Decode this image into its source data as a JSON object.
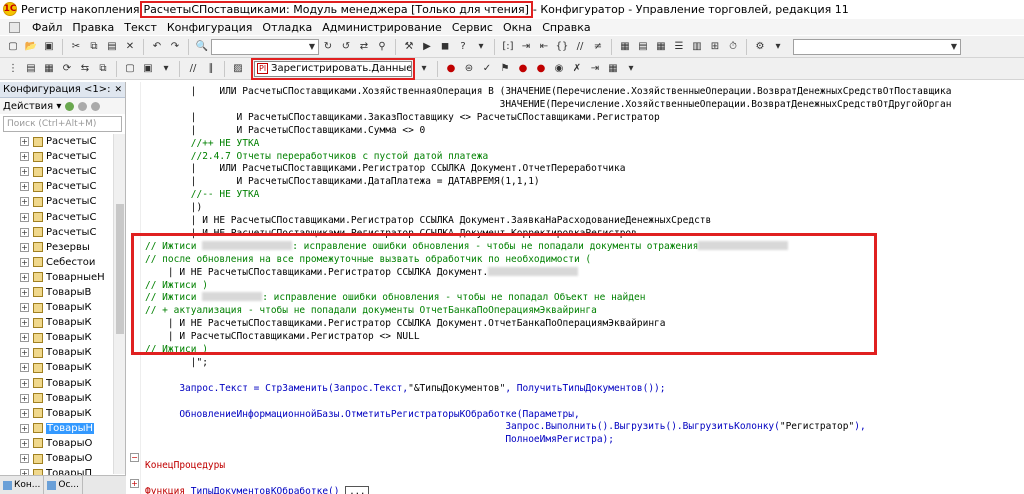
{
  "titlebar": {
    "prefix": "Регистр накопления ",
    "highlighted": "РасчетыСПоставщиками: Модуль менеджера [Только для чтения]",
    "suffix": " - Конфигуратор - Управление торговлей, редакция 11",
    "app_icon": "1С"
  },
  "menu": [
    "Файл",
    "Правка",
    "Текст",
    "Конфигурация",
    "Отладка",
    "Администрирование",
    "Сервис",
    "Окна",
    "Справка"
  ],
  "toolbar": {
    "search_placeholder": "",
    "register_combo": "Зарегистрировать.ДанныеКОбр"
  },
  "left_panel": {
    "title": "Конфигурация <1>:",
    "close": "✕",
    "actions_label": "Действия ▾",
    "search_placeholder": "Поиск (Ctrl+Alt+M)",
    "items": [
      {
        "label": "РасчетыС",
        "selected": false
      },
      {
        "label": "РасчетыС",
        "selected": false
      },
      {
        "label": "РасчетыС",
        "selected": false
      },
      {
        "label": "РасчетыС",
        "selected": false
      },
      {
        "label": "РасчетыС",
        "selected": false
      },
      {
        "label": "РасчетыС",
        "selected": false
      },
      {
        "label": "РасчетыС",
        "selected": false
      },
      {
        "label": "Резервы",
        "selected": false
      },
      {
        "label": "Себестои",
        "selected": false
      },
      {
        "label": "ТоварныеН",
        "selected": false
      },
      {
        "label": "ТоварыВ",
        "selected": false
      },
      {
        "label": "ТоварыК",
        "selected": false
      },
      {
        "label": "ТоварыК",
        "selected": false
      },
      {
        "label": "ТоварыК",
        "selected": false
      },
      {
        "label": "ТоварыК",
        "selected": false
      },
      {
        "label": "ТоварыК",
        "selected": false
      },
      {
        "label": "ТоварыК",
        "selected": false
      },
      {
        "label": "ТоварыК",
        "selected": false
      },
      {
        "label": "ТоварыК",
        "selected": false
      },
      {
        "label": "ТоварыН",
        "selected": true
      },
      {
        "label": "ТоварыО",
        "selected": false
      },
      {
        "label": "ТоварыО",
        "selected": false
      },
      {
        "label": "ТоварыП",
        "selected": false
      }
    ],
    "bottom_tabs": [
      "Кон...",
      "Ос..."
    ]
  },
  "code": {
    "lines": [
      {
        "indent": 8,
        "parts": [
          {
            "c": "",
            "t": "|    ИЛИ РасчетыСПоставщиками.ХозяйственнаяОперация В (ЗНАЧЕНИЕ(Перечисление.ХозяйственныеОперации.ВозвратДенежныхСредствОтПоставщика"
          }
        ]
      },
      {
        "indent": 8,
        "parts": [
          {
            "c": "",
            "t": "                                                      ЗНАЧЕНИЕ(Перечисление.ХозяйственныеОперации.ВозвратДенежныхСредствОтДругойОрган"
          }
        ]
      },
      {
        "indent": 8,
        "parts": [
          {
            "c": "",
            "t": "|       И РасчетыСПоставщиками.ЗаказПоставщику <> РасчетыСПоставщиками.Регистратор"
          }
        ]
      },
      {
        "indent": 8,
        "parts": [
          {
            "c": "",
            "t": "|       И РасчетыСПоставщиками.Сумма <> 0"
          }
        ]
      },
      {
        "indent": 8,
        "parts": [
          {
            "c": "cmt",
            "t": "//++ НЕ УТКА"
          }
        ]
      },
      {
        "indent": 8,
        "parts": [
          {
            "c": "cmt",
            "t": "//2.4.7 Отчеты переработчиков с пустой датой платежа"
          }
        ]
      },
      {
        "indent": 8,
        "parts": [
          {
            "c": "",
            "t": "|    ИЛИ РасчетыСПоставщиками.Регистратор ССЫЛКА Документ.ОтчетПереработчика"
          }
        ]
      },
      {
        "indent": 8,
        "parts": [
          {
            "c": "",
            "t": "|       И РасчетыСПоставщиками.ДатаПлатежа = ДАТАВРЕМЯ(1,1,1)"
          }
        ]
      },
      {
        "indent": 8,
        "parts": [
          {
            "c": "cmt",
            "t": "//-- НЕ УТКА"
          }
        ]
      },
      {
        "indent": 8,
        "parts": [
          {
            "c": "",
            "t": "|)"
          }
        ]
      },
      {
        "indent": 8,
        "parts": [
          {
            "c": "",
            "t": "| И НЕ РасчетыСПоставщиками.Регистратор ССЫЛКА Документ.ЗаявкаНаРасходованиеДенежныхСредств"
          }
        ]
      },
      {
        "indent": 8,
        "parts": [
          {
            "c": "",
            "t": "| И НЕ РасчетыСПоставщиками.Регистратор ССЫЛКА Документ.КорректировкаРегистров"
          }
        ]
      },
      {
        "indent": 0,
        "parts": [
          {
            "c": "cmt",
            "t": "// Ижтиси "
          },
          {
            "c": "blur",
            "t": ""
          },
          {
            "c": "cmt",
            "t": ": исправление ошибки обновления - чтобы не попадали документы отражения"
          },
          {
            "c": "blur",
            "t": ""
          }
        ]
      },
      {
        "indent": 0,
        "parts": [
          {
            "c": "cmt",
            "t": "// после обновления на все промежуточные вызвать обработчик по необходимости ("
          }
        ]
      },
      {
        "indent": 0,
        "parts": [
          {
            "c": "",
            "t": "    | И НЕ РасчетыСПоставщиками.Регистратор ССЫЛКА Документ."
          },
          {
            "c": "blur",
            "t": ""
          }
        ]
      },
      {
        "indent": 0,
        "parts": [
          {
            "c": "cmt",
            "t": "// Ижтиси )"
          }
        ]
      },
      {
        "indent": 0,
        "parts": [
          {
            "c": "cmt",
            "t": "// Ижтиси "
          },
          {
            "c": "blur s",
            "t": ""
          },
          {
            "c": "cmt",
            "t": ": исправление ошибки обновления - чтобы не попадал Объект не найден"
          }
        ]
      },
      {
        "indent": 0,
        "parts": [
          {
            "c": "cmt",
            "t": "// + актуализация - чтобы не попадали документы ОтчетБанкаПоОперациямЭквайринга"
          }
        ]
      },
      {
        "indent": 0,
        "parts": [
          {
            "c": "",
            "t": "    | И НЕ РасчетыСПоставщиками.Регистратор ССЫЛКА Документ.ОтчетБанкаПоОперациямЭквайринга"
          }
        ]
      },
      {
        "indent": 0,
        "parts": [
          {
            "c": "",
            "t": "    | И РасчетыСПоставщиками.Регистратор <> NULL"
          }
        ]
      },
      {
        "indent": 0,
        "parts": [
          {
            "c": "cmt",
            "t": "// Ижтиси )"
          }
        ]
      },
      {
        "indent": 8,
        "parts": [
          {
            "c": "",
            "t": "|\";"
          }
        ]
      },
      {
        "indent": 0,
        "parts": [
          {
            "c": "",
            "t": ""
          }
        ]
      },
      {
        "indent": 6,
        "parts": [
          {
            "c": "fn",
            "t": "Запрос.Текст = СтрЗаменить(Запрос.Текст,"
          },
          {
            "c": "",
            "t": "\"&ТипыДокументов\""
          },
          {
            "c": "fn",
            "t": ", ПолучитьТипыДокументов());"
          }
        ]
      },
      {
        "indent": 0,
        "parts": [
          {
            "c": "",
            "t": ""
          }
        ]
      },
      {
        "indent": 6,
        "parts": [
          {
            "c": "fn",
            "t": "ОбновлениеИнформационнойБазы.ОтметитьРегистраторыКОбработке(Параметры,"
          }
        ]
      },
      {
        "indent": 6,
        "parts": [
          {
            "c": "fn",
            "t": "                                                         Запрос.Выполнить().Выгрузить().ВыгрузитьКолонку("
          },
          {
            "c": "",
            "t": "\"Регистратор\""
          },
          {
            "c": "fn",
            "t": "),"
          }
        ]
      },
      {
        "indent": 6,
        "parts": [
          {
            "c": "fn",
            "t": "                                                         ПолноеИмяРегистра);"
          }
        ]
      },
      {
        "indent": 0,
        "parts": [
          {
            "c": "",
            "t": ""
          }
        ]
      },
      {
        "indent": 0,
        "parts": [
          {
            "c": "kw",
            "t": "КонецПроцедуры"
          }
        ]
      },
      {
        "indent": 0,
        "parts": [
          {
            "c": "",
            "t": ""
          }
        ]
      },
      {
        "indent": 0,
        "parts": [
          {
            "c": "kw",
            "t": "Функция "
          },
          {
            "c": "fn",
            "t": "ТипыДокументовКОбработке()"
          },
          {
            "c": "",
            "t": " "
          },
          {
            "c": "dots",
            "t": "..."
          }
        ]
      }
    ]
  },
  "colors": {
    "highlight_border": "#e02020",
    "comment": "#008000",
    "keyword": "#c00000",
    "identifier": "#0000c0",
    "selection": "#3399ff"
  }
}
